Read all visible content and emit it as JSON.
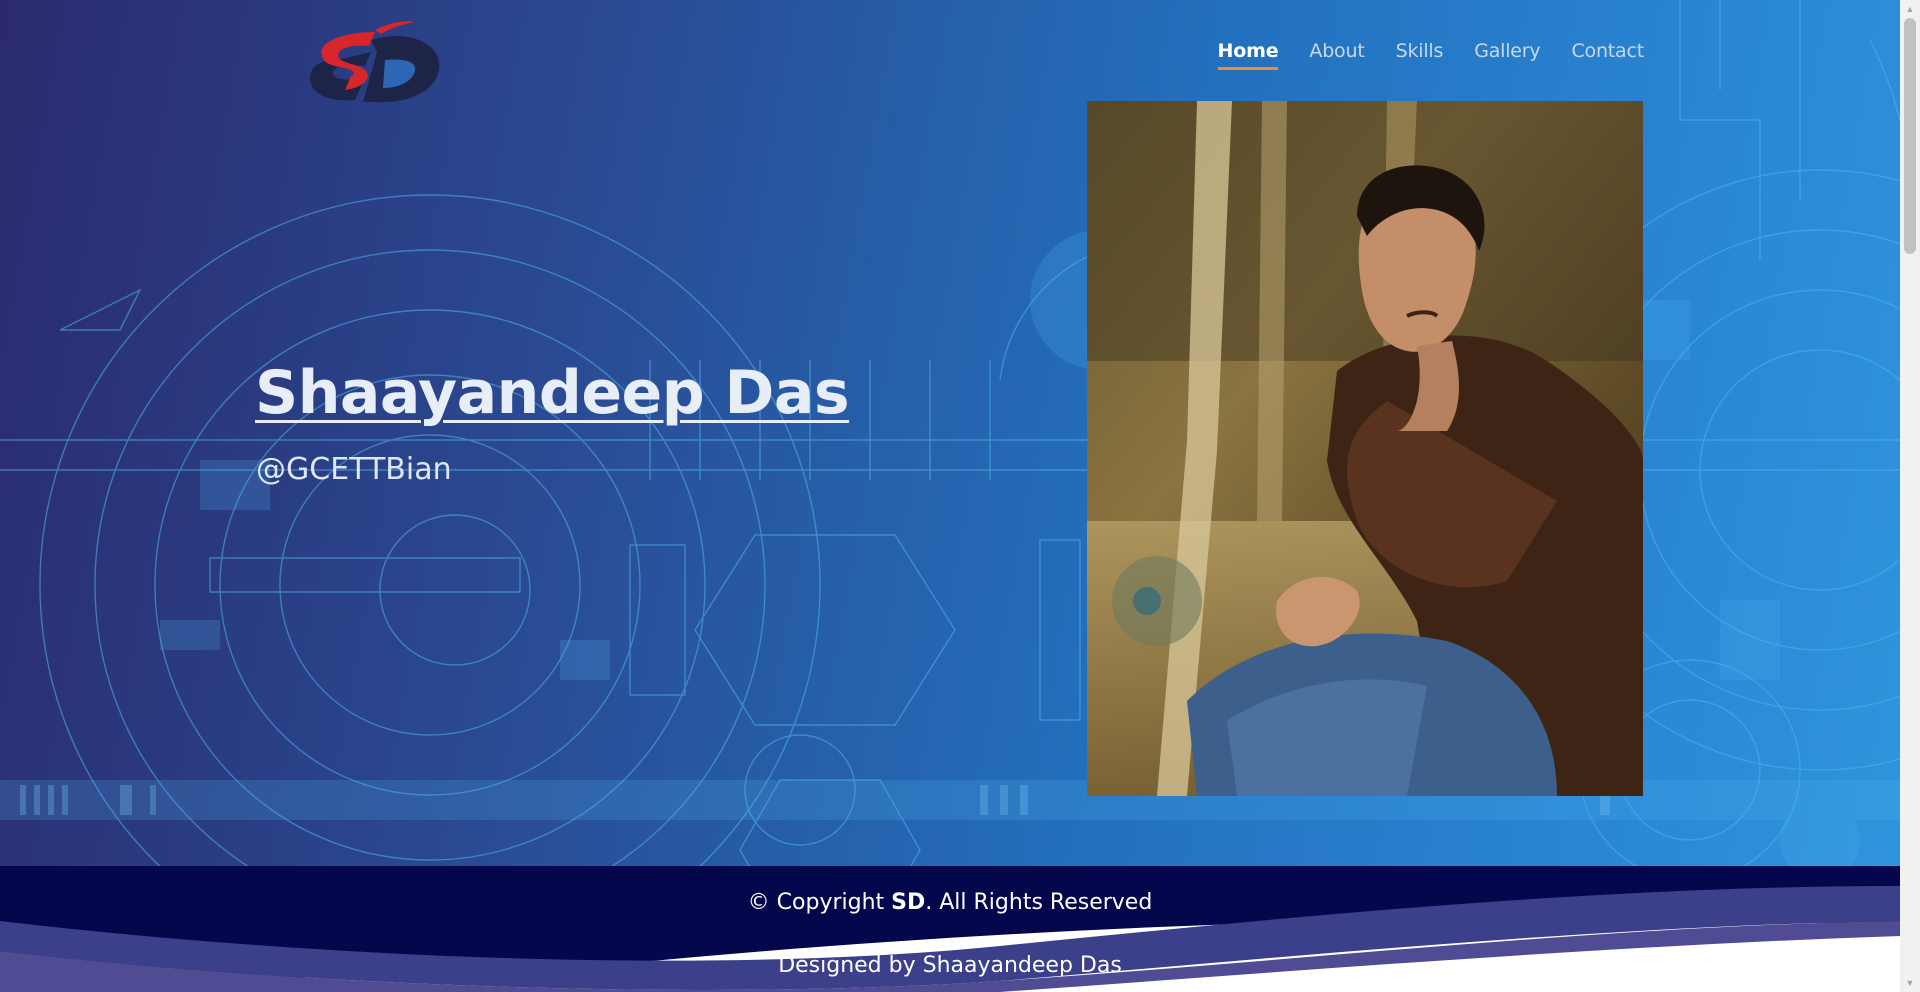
{
  "logo": {
    "text": "SD"
  },
  "nav": {
    "items": [
      {
        "label": "Home"
      },
      {
        "label": "About"
      },
      {
        "label": "Skills"
      },
      {
        "label": "Gallery"
      },
      {
        "label": "Contact"
      }
    ],
    "active": "Home",
    "accent_color": "#f48c2a"
  },
  "hero": {
    "name": "Shaayandeep Das",
    "handle": "@GCETTBian",
    "photo_icon": "portrait-photo"
  },
  "footer": {
    "copyright_prefix": "© Copyright ",
    "copyright_brand": "SD",
    "copyright_suffix": ". All Rights Reserved",
    "designed_by": "Designed by Shaayandeep Das"
  },
  "colors": {
    "hero_gradient_start": "#2b2a6e",
    "hero_gradient_end": "#2f95dc",
    "footer_dark": "#05074d",
    "footer_wave": "#3c3f8a",
    "logo_red": "#d7262c",
    "logo_navy": "#1d2447"
  }
}
